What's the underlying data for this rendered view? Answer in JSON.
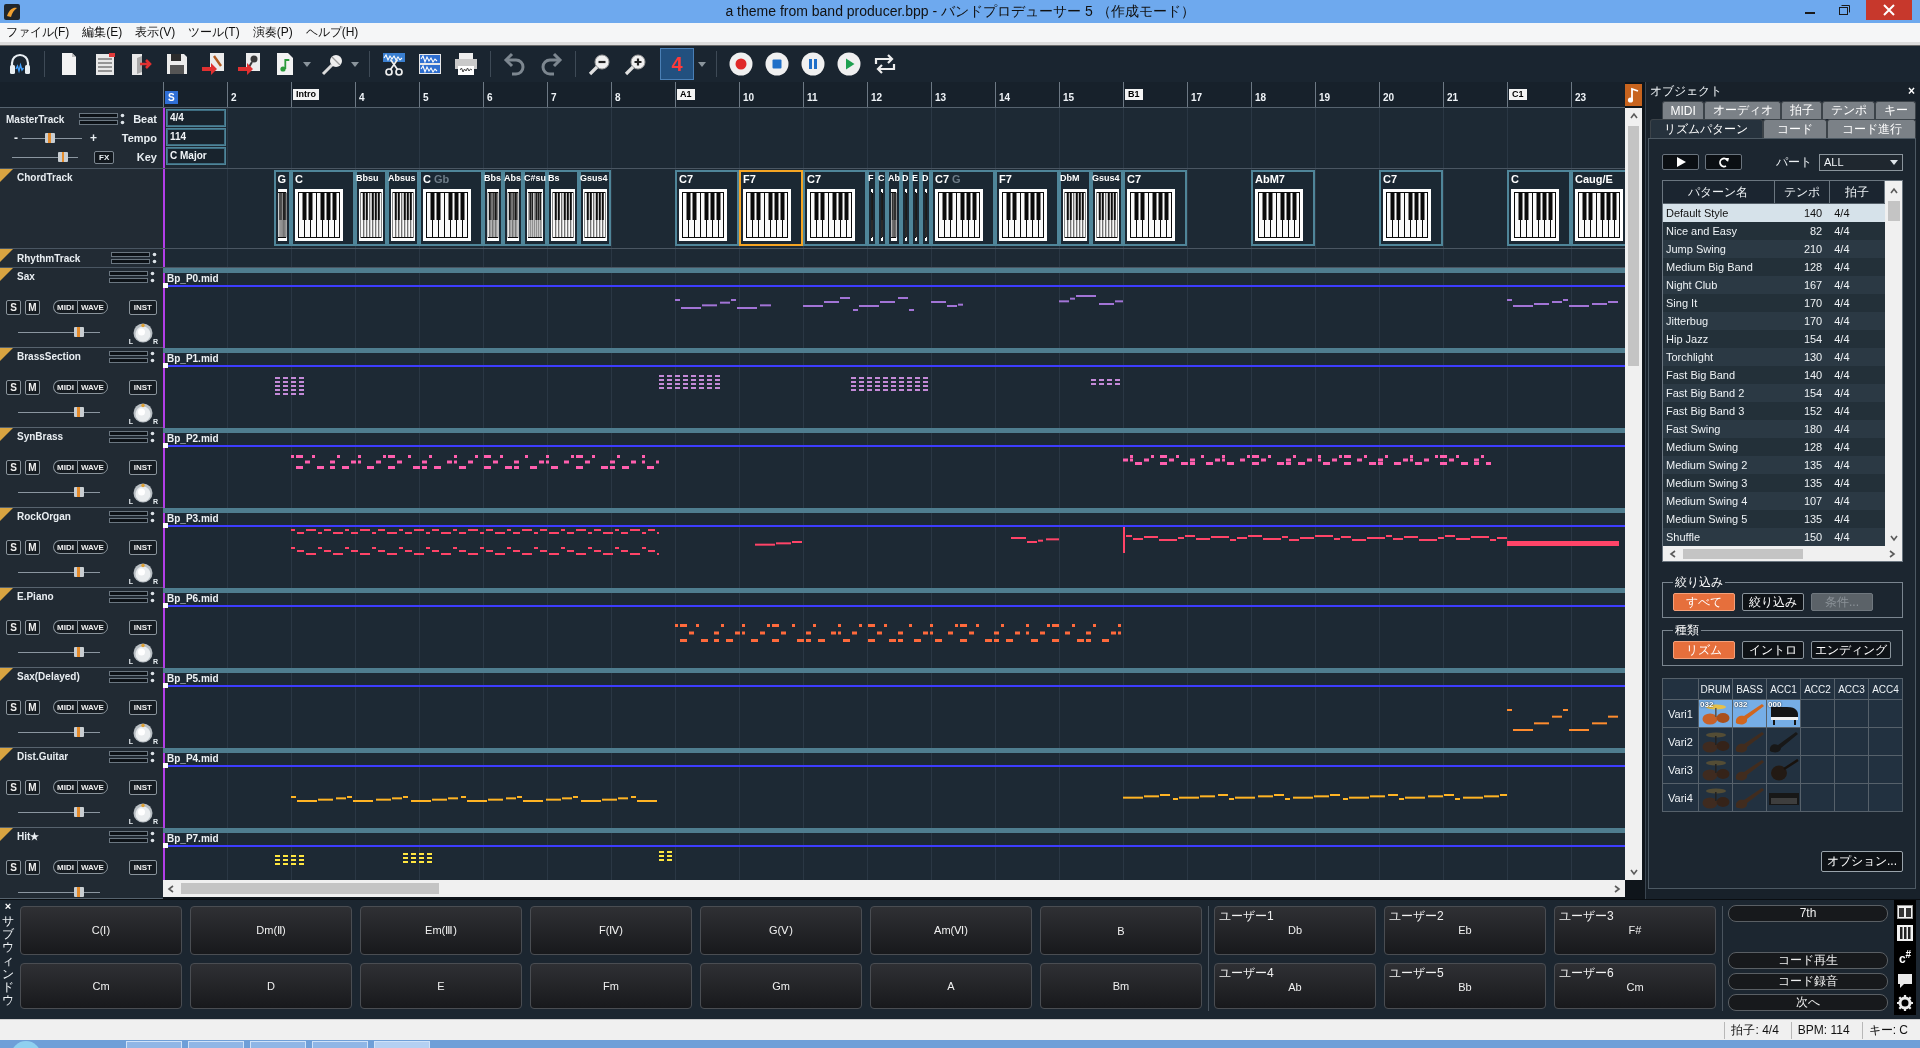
{
  "window": {
    "title": "a theme from band producer.bpp - バンドプロデューサー 5 （作成モード）"
  },
  "menu": [
    "ファイル(F)",
    "編集(E)",
    "表示(V)",
    "ツール(T)",
    "演奏(P)",
    "ヘルプ(H)"
  ],
  "toolbar": {
    "quantize": {
      "label": "4",
      "selected": true
    }
  },
  "ruler": [
    {
      "kind": "start",
      "label": "S"
    },
    {
      "kind": "bar",
      "label": "2"
    },
    {
      "kind": "section",
      "label": "Intro"
    },
    {
      "kind": "bar",
      "label": "4"
    },
    {
      "kind": "bar",
      "label": "5"
    },
    {
      "kind": "bar",
      "label": "6"
    },
    {
      "kind": "bar",
      "label": "7"
    },
    {
      "kind": "bar",
      "label": "8"
    },
    {
      "kind": "section",
      "label": "A1"
    },
    {
      "kind": "bar",
      "label": "10"
    },
    {
      "kind": "bar",
      "label": "11"
    },
    {
      "kind": "bar",
      "label": "12"
    },
    {
      "kind": "bar",
      "label": "13"
    },
    {
      "kind": "bar",
      "label": "14"
    },
    {
      "kind": "bar",
      "label": "15"
    },
    {
      "kind": "section",
      "label": "B1"
    },
    {
      "kind": "bar",
      "label": "17"
    },
    {
      "kind": "bar",
      "label": "18"
    },
    {
      "kind": "bar",
      "label": "19"
    },
    {
      "kind": "bar",
      "label": "20"
    },
    {
      "kind": "bar",
      "label": "21"
    },
    {
      "kind": "section",
      "label": "C1"
    },
    {
      "kind": "bar",
      "label": "23"
    }
  ],
  "master_track": {
    "name": "MasterTrack",
    "fields": [
      {
        "label": "Beat",
        "value": "4/4"
      },
      {
        "label": "Tempo",
        "value": "114"
      },
      {
        "label": "Key",
        "value": "C Major"
      }
    ],
    "minus": "-",
    "plus": "+",
    "fx": "FX",
    "volume": {
      "level": 0.46
    },
    "balance": {
      "level": 0.83
    }
  },
  "chord_track": {
    "name": "ChordTrack",
    "measures": [
      [
        {
          "kind": "gap"
        }
      ],
      [
        {
          "kind": "gap"
        },
        {
          "kind": "gap"
        },
        {
          "kind": "gap"
        },
        {
          "kind": "chord",
          "label": "G",
          "selected": false
        }
      ],
      [
        {
          "kind": "chord",
          "label": "C",
          "selected": false
        }
      ],
      [
        {
          "kind": "chord",
          "label": "Bbsu",
          "selected": false
        },
        {
          "kind": "chord",
          "label": "Absus",
          "selected": false
        }
      ],
      [
        {
          "kind": "chord",
          "label": "C",
          "ghost": "Gb",
          "selected": false
        }
      ],
      [
        {
          "kind": "chord",
          "label": "Bbs",
          "selected": false
        },
        {
          "kind": "chord",
          "label": "Abs",
          "selected": false
        },
        {
          "kind": "chord",
          "label": "C#su",
          "selected": false
        }
      ],
      [
        {
          "kind": "chord",
          "label": "Bs",
          "selected": false
        },
        {
          "kind": "chord",
          "label": "Gsus4",
          "selected": false
        }
      ],
      [
        {
          "kind": "gap"
        }
      ],
      [
        {
          "kind": "chord",
          "label": "C7",
          "selected": false
        }
      ],
      [
        {
          "kind": "chord",
          "label": "F7",
          "selected": true
        }
      ],
      [
        {
          "kind": "chord",
          "label": "C7",
          "selected": false
        }
      ],
      [
        {
          "kind": "chord",
          "label": "F",
          "selected": false
        },
        {
          "kind": "chord",
          "label": "C",
          "selected": false
        },
        {
          "kind": "chord",
          "label": "Ab",
          "selected": false
        },
        {
          "kind": "chord",
          "label": "D",
          "selected": false
        },
        {
          "kind": "chord",
          "label": "E",
          "selected": false
        },
        {
          "kind": "chord",
          "label": "D",
          "selected": false
        }
      ],
      [
        {
          "kind": "chord",
          "label": "C7",
          "ghost": "G",
          "selected": false
        }
      ],
      [
        {
          "kind": "chord",
          "label": "F7",
          "selected": false
        }
      ],
      [
        {
          "kind": "chord",
          "label": "DbM",
          "selected": false
        },
        {
          "kind": "chord",
          "label": "Gsus4",
          "selected": false
        }
      ],
      [
        {
          "kind": "chord",
          "label": "C7",
          "selected": false
        }
      ],
      [
        {
          "kind": "gap"
        }
      ],
      [
        {
          "kind": "chord",
          "label": "AbM7",
          "selected": false
        }
      ],
      [
        {
          "kind": "gap"
        }
      ],
      [
        {
          "kind": "chord",
          "label": "C7",
          "selected": false
        }
      ],
      [
        {
          "kind": "gap"
        }
      ],
      [
        {
          "kind": "chord",
          "label": "C",
          "selected": false
        }
      ],
      [
        {
          "kind": "chord",
          "label": "Caug/E",
          "selected": false
        }
      ]
    ]
  },
  "rhythm_track": {
    "name": "RhythmTrack"
  },
  "tracks": [
    {
      "name": "Sax",
      "file": "Bp_P0.mid",
      "color": "#a274d6",
      "solo": "S",
      "mute": "M",
      "midi": "MIDI",
      "wave": "WAVE",
      "inst": "INST",
      "volume": {
        "level": 0.78
      },
      "pan": {
        "left": "L",
        "right": "R"
      }
    },
    {
      "name": "BrassSection",
      "file": "Bp_P1.mid",
      "color": "#c48ad8",
      "solo": "S",
      "mute": "M",
      "midi": "MIDI",
      "wave": "WAVE",
      "inst": "INST",
      "volume": {
        "level": 0.78
      },
      "pan": {
        "left": "L",
        "right": "R"
      }
    },
    {
      "name": "SynBrass",
      "file": "Bp_P2.mid",
      "color": "#ff5fae",
      "solo": "S",
      "mute": "M",
      "midi": "MIDI",
      "wave": "WAVE",
      "inst": "INST",
      "volume": {
        "level": 0.78
      },
      "pan": {
        "left": "L",
        "right": "R"
      }
    },
    {
      "name": "RockOrgan",
      "file": "Bp_P3.mid",
      "color": "#ff4468",
      "solo": "S",
      "mute": "M",
      "midi": "MIDI",
      "wave": "WAVE",
      "inst": "INST",
      "volume": {
        "level": 0.78
      },
      "pan": {
        "left": "L",
        "right": "R"
      }
    },
    {
      "name": "E.Piano",
      "file": "Bp_P6.mid",
      "color": "#ff6a3c",
      "solo": "S",
      "mute": "M",
      "midi": "MIDI",
      "wave": "WAVE",
      "inst": "INST",
      "volume": {
        "level": 0.78
      },
      "pan": {
        "left": "L",
        "right": "R"
      }
    },
    {
      "name": "Sax(Delayed)",
      "file": "Bp_P5.mid",
      "color": "#ff8c2e",
      "solo": "S",
      "mute": "M",
      "midi": "MIDI",
      "wave": "WAVE",
      "inst": "INST",
      "volume": {
        "level": 0.78
      },
      "pan": {
        "left": "L",
        "right": "R"
      }
    },
    {
      "name": "Dist.Guitar",
      "file": "Bp_P4.mid",
      "color": "#ffb424",
      "solo": "S",
      "mute": "M",
      "midi": "MIDI",
      "wave": "WAVE",
      "inst": "INST",
      "volume": {
        "level": 0.78
      },
      "pan": {
        "left": "L",
        "right": "R"
      }
    },
    {
      "name": "Hit★",
      "file": "Bp_P7.mid",
      "color": "#ffe640",
      "solo": "S",
      "mute": "M",
      "midi": "MIDI",
      "wave": "WAVE",
      "inst": "INST",
      "volume": {
        "level": 0.78
      }
    }
  ],
  "object_panel": {
    "title": "オブジェクト",
    "close": "×",
    "tab_rows": [
      [
        {
          "label": "MIDI",
          "selected": false
        },
        {
          "label": "オーディオ",
          "selected": false
        },
        {
          "label": "拍子",
          "selected": false
        },
        {
          "label": "テンポ",
          "selected": false
        },
        {
          "label": "キー",
          "selected": false
        }
      ],
      [
        {
          "label": "リズムパターン",
          "selected": true
        },
        {
          "label": "コード",
          "selected": false
        },
        {
          "label": "コード進行",
          "selected": false
        }
      ]
    ],
    "part_label": "パート",
    "part_value": "ALL",
    "columns": [
      "パターン名",
      "テンポ",
      "拍子"
    ],
    "rows": [
      {
        "name": "Default Style",
        "tempo": "140",
        "beat": "4/4",
        "selected": true
      },
      {
        "name": "Nice and Easy",
        "tempo": "82",
        "beat": "4/4",
        "selected": false
      },
      {
        "name": "Jump Swing",
        "tempo": "210",
        "beat": "4/4",
        "selected": false
      },
      {
        "name": "Medium Big Band",
        "tempo": "128",
        "beat": "4/4",
        "selected": false
      },
      {
        "name": "Night Club",
        "tempo": "167",
        "beat": "4/4",
        "selected": false
      },
      {
        "name": "Sing It",
        "tempo": "170",
        "beat": "4/4",
        "selected": false
      },
      {
        "name": "Jitterbug",
        "tempo": "170",
        "beat": "4/4",
        "selected": false
      },
      {
        "name": "Hip Jazz",
        "tempo": "154",
        "beat": "4/4",
        "selected": false
      },
      {
        "name": "Torchlight",
        "tempo": "130",
        "beat": "4/4",
        "selected": false
      },
      {
        "name": "Fast Big Band",
        "tempo": "140",
        "beat": "4/4",
        "selected": false
      },
      {
        "name": "Fast Big Band 2",
        "tempo": "154",
        "beat": "4/4",
        "selected": false
      },
      {
        "name": "Fast Big Band 3",
        "tempo": "152",
        "beat": "4/4",
        "selected": false
      },
      {
        "name": "Fast Swing",
        "tempo": "180",
        "beat": "4/4",
        "selected": false
      },
      {
        "name": "Medium Swing",
        "tempo": "128",
        "beat": "4/4",
        "selected": false
      },
      {
        "name": "Medium Swing 2",
        "tempo": "135",
        "beat": "4/4",
        "selected": false
      },
      {
        "name": "Medium Swing 3",
        "tempo": "135",
        "beat": "4/4",
        "selected": false
      },
      {
        "name": "Medium Swing 4",
        "tempo": "107",
        "beat": "4/4",
        "selected": false
      },
      {
        "name": "Medium Swing 5",
        "tempo": "135",
        "beat": "4/4",
        "selected": false
      },
      {
        "name": "Shuffle",
        "tempo": "150",
        "beat": "4/4",
        "selected": false
      }
    ],
    "filter": {
      "title": "絞り込み",
      "buttons": [
        {
          "label": "すべて",
          "selected": true,
          "disabled": false
        },
        {
          "label": "絞り込み",
          "selected": false,
          "disabled": false
        },
        {
          "label": "条件...",
          "selected": false,
          "disabled": true
        }
      ]
    },
    "kind_group": {
      "title": "種類",
      "buttons": [
        {
          "label": "リズム",
          "selected": true
        },
        {
          "label": "イントロ",
          "selected": false
        },
        {
          "label": "エンディング",
          "selected": false
        }
      ]
    },
    "variations": {
      "columns": [
        "DRUM",
        "BASS",
        "ACC1",
        "ACC2",
        "ACC3",
        "ACC4"
      ],
      "rows": [
        {
          "label": "Vari1",
          "selected": true,
          "cells": [
            {
              "kind": "drums",
              "number": "032"
            },
            {
              "kind": "bass",
              "number": "032"
            },
            {
              "kind": "piano",
              "number": "000"
            },
            {
              "kind": "empty"
            },
            {
              "kind": "empty"
            },
            {
              "kind": "empty"
            }
          ]
        },
        {
          "label": "Vari2",
          "selected": false,
          "cells": [
            {
              "kind": "drums"
            },
            {
              "kind": "bass"
            },
            {
              "kind": "guitar"
            },
            {
              "kind": "empty"
            },
            {
              "kind": "empty"
            },
            {
              "kind": "empty"
            }
          ]
        },
        {
          "label": "Vari3",
          "selected": false,
          "cells": [
            {
              "kind": "drums"
            },
            {
              "kind": "bass"
            },
            {
              "kind": "violin"
            },
            {
              "kind": "empty"
            },
            {
              "kind": "empty"
            },
            {
              "kind": "empty"
            }
          ]
        },
        {
          "label": "Vari4",
          "selected": false,
          "cells": [
            {
              "kind": "drums"
            },
            {
              "kind": "bass"
            },
            {
              "kind": "keyboard"
            },
            {
              "kind": "empty"
            },
            {
              "kind": "empty"
            },
            {
              "kind": "empty"
            }
          ]
        }
      ]
    },
    "option_button": "オプション..."
  },
  "sub_window": {
    "title": "サブウィンドウ",
    "close": "×",
    "pads": [
      [
        "C(Ⅰ)",
        "Dm(Ⅱ)",
        "Em(Ⅲ)",
        "F(Ⅳ)",
        "G(Ⅴ)",
        "Am(Ⅵ)",
        "B"
      ],
      [
        "Cm",
        "D",
        "E",
        "Fm",
        "Gm",
        "A",
        "Bm"
      ]
    ],
    "user_pads": [
      [
        {
          "label": "ユーザー1",
          "chord": "Db"
        },
        {
          "label": "ユーザー2",
          "chord": "Eb"
        },
        {
          "label": "ユーザー3",
          "chord": "F#"
        }
      ],
      [
        {
          "label": "ユーザー4",
          "chord": "Ab"
        },
        {
          "label": "ユーザー5",
          "chord": "Bb"
        },
        {
          "label": "ユーザー6",
          "chord": "Cm"
        }
      ]
    ],
    "side_buttons": [
      "7th",
      "コード再生",
      "コード録音",
      "次へ"
    ],
    "chord_symbol": "c$^{#}$"
  },
  "status_bar": [
    "拍子: 4/4",
    "BPM: 114",
    "キー: C"
  ]
}
